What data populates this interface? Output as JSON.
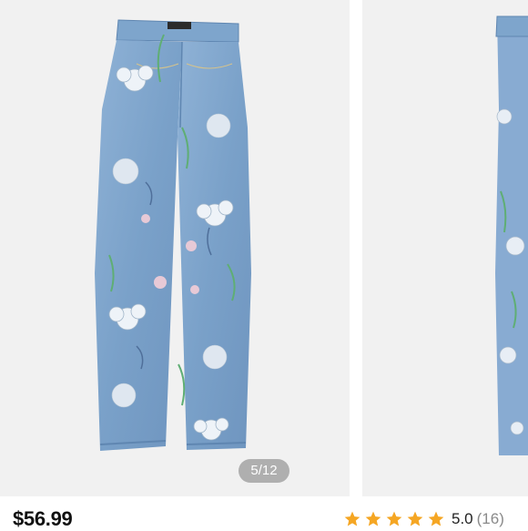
{
  "gallery": {
    "counter": "5/12",
    "main_image_alt": "floral print jeans",
    "next_image_alt": "floral print jeans side view"
  },
  "product": {
    "price": "$56.99",
    "rating_value": "5.0",
    "rating_count": "(16)",
    "stars": 5,
    "star_color": "#f5a623"
  }
}
